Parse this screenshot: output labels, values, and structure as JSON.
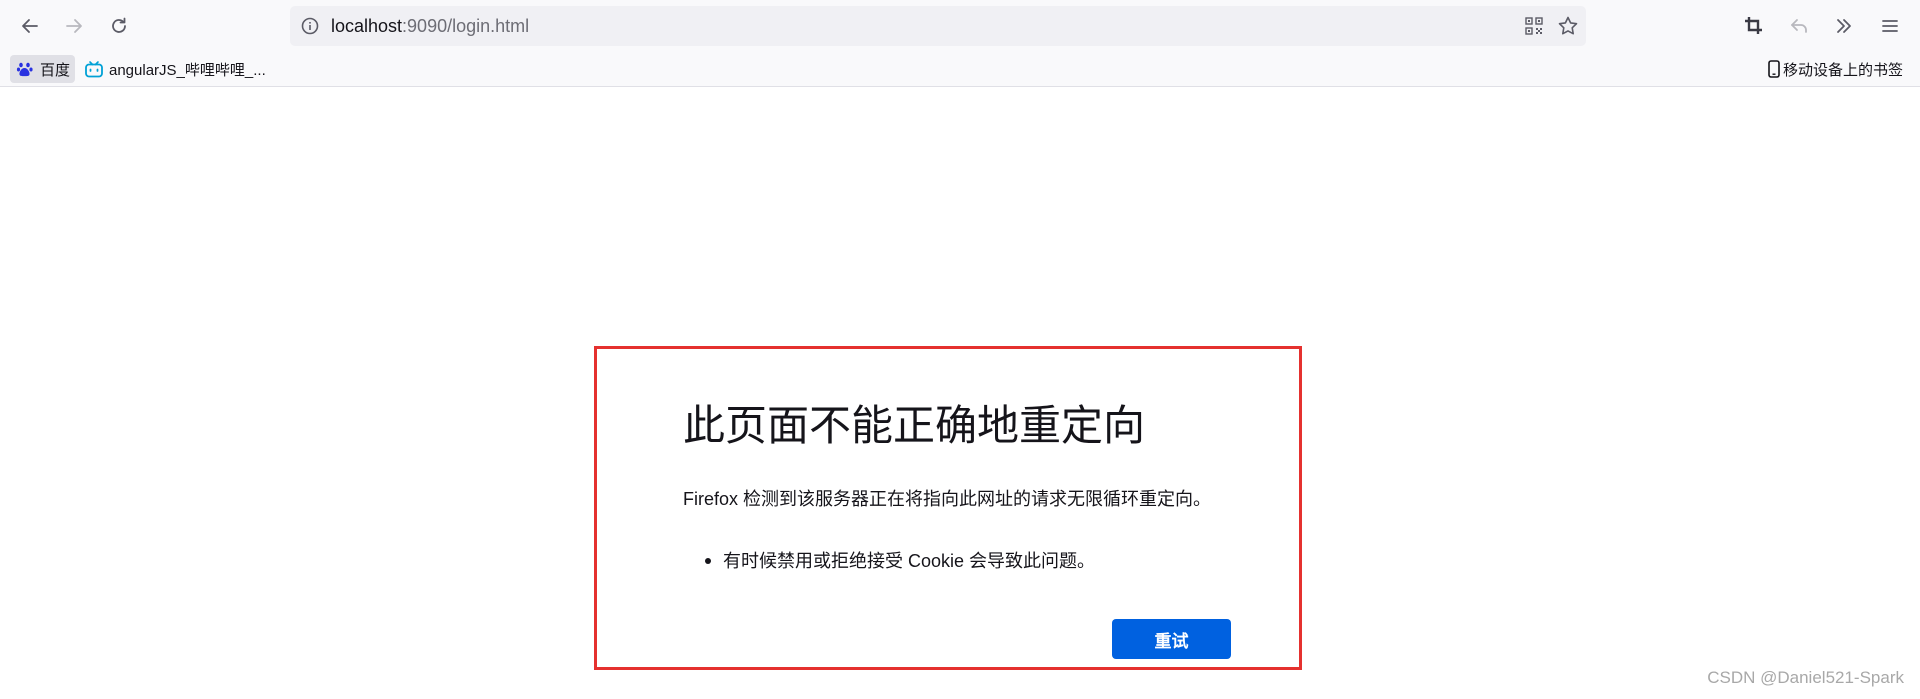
{
  "browser": {
    "url_host": "localhost",
    "url_rest": ":9090/login.html",
    "icons": {
      "back": "back-arrow-icon",
      "forward": "forward-arrow-icon",
      "reload": "reload-icon",
      "site_info": "info-icon",
      "qr": "qr-code-icon",
      "bookmark_star": "star-icon",
      "screenshot": "crop-icon",
      "undo": "undo-icon",
      "overflow": "double-chevron-icon",
      "menu": "hamburger-menu-icon"
    }
  },
  "bookmarks": {
    "items": [
      {
        "label": "百度",
        "icon": "baidu-paw-icon"
      },
      {
        "label": "angularJS_哔哩哔哩_...",
        "icon": "bilibili-icon"
      }
    ],
    "mobile_label": "移动设备上的书签",
    "mobile_icon": "mobile-device-icon"
  },
  "error": {
    "title": "此页面不能正确地重定向",
    "description": "Firefox 检测到该服务器正在将指向此网址的请求无限循环重定向。",
    "bullets": [
      "有时候禁用或拒绝接受 Cookie 会导致此问题。"
    ],
    "retry_label": "重试"
  },
  "watermark": "CSDN @Daniel521-Spark",
  "colors": {
    "accent": "#0061e0",
    "highlight_border": "#e5312f",
    "bilibili": "#00a1d6",
    "baidu": "#2932e1"
  }
}
